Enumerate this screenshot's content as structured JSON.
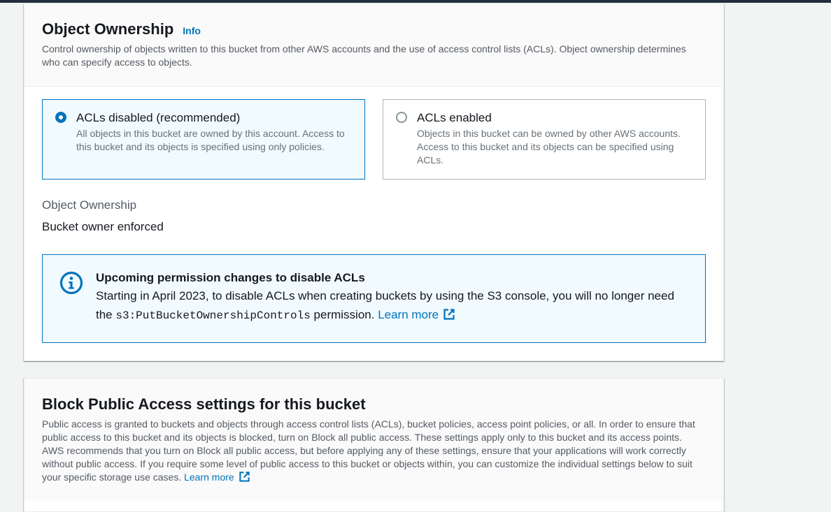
{
  "colors": {
    "accent": "#0073bb",
    "text_primary": "#16191f",
    "text_secondary": "#545b64",
    "selected_bg": "#f1faff",
    "page_bg": "#f2f3f3"
  },
  "object_ownership": {
    "title": "Object Ownership",
    "info_label": "Info",
    "description": "Control ownership of objects written to this bucket from other AWS accounts and the use of access control lists (ACLs). Object ownership determines who can specify access to objects.",
    "options": [
      {
        "title": "ACLs disabled (recommended)",
        "description": "All objects in this bucket are owned by this account. Access to this bucket and its objects is specified using only policies.",
        "selected": true
      },
      {
        "title": "ACLs enabled",
        "description": "Objects in this bucket can be owned by other AWS accounts. Access to this bucket and its objects can be specified using ACLs.",
        "selected": false
      }
    ],
    "field_label": "Object Ownership",
    "field_value": "Bucket owner enforced",
    "alert": {
      "icon": "info-icon",
      "title": "Upcoming permission changes to disable ACLs",
      "text_before": "Starting in April 2023, to disable ACLs when creating buckets by using the S3 console, you will no longer need the ",
      "code": "s3:PutBucketOwnershipControls",
      "text_after": " permission. ",
      "link_label": "Learn more",
      "link_icon": "external-link-icon"
    }
  },
  "block_public_access": {
    "title": "Block Public Access settings for this bucket",
    "description": "Public access is granted to buckets and objects through access control lists (ACLs), bucket policies, access point policies, or all. In order to ensure that public access to this bucket and its objects is blocked, turn on Block all public access. These settings apply only to this bucket and its access points. AWS recommends that you turn on Block all public access, but before applying any of these settings, ensure that your applications will work correctly without public access. If you require some level of public access to this bucket or objects within, you can customize the individual settings below to suit your specific storage use cases.",
    "link_label": "Learn more",
    "link_icon": "external-link-icon"
  }
}
